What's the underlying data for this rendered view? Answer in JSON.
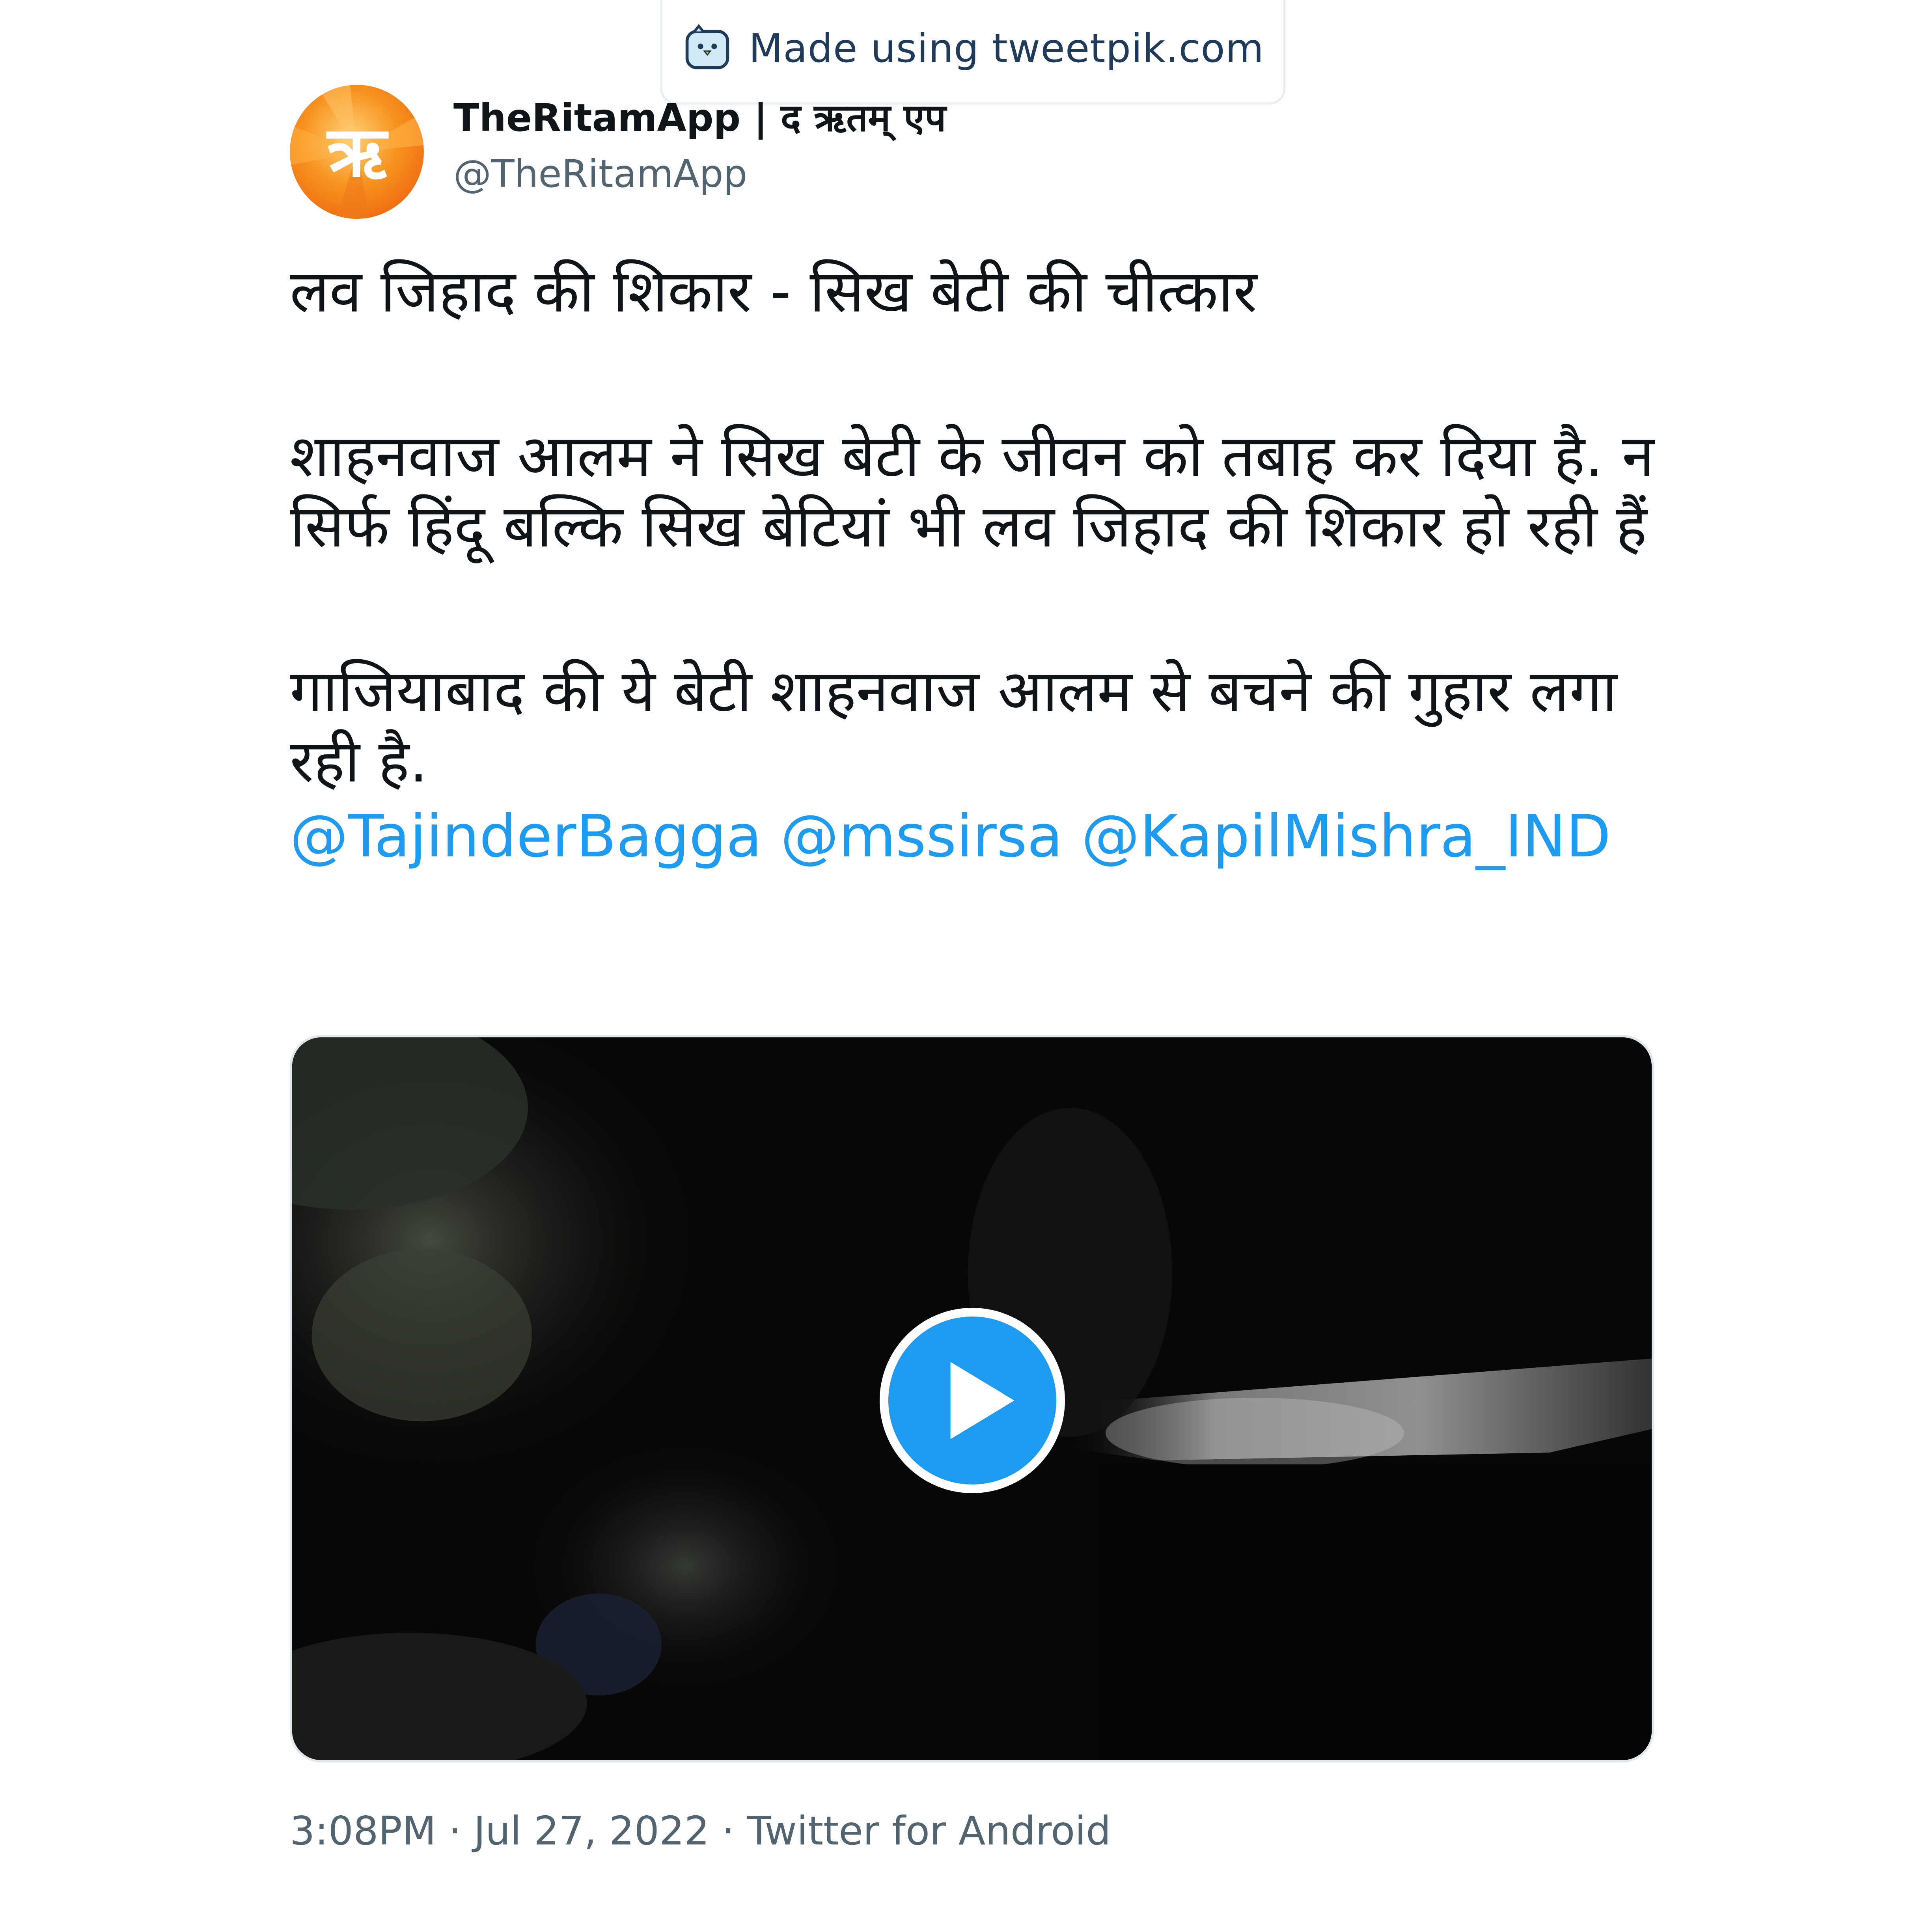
{
  "watermark": {
    "text": "Made using tweetpik.com",
    "icon": "bird-face-icon"
  },
  "author": {
    "name": "TheRitamApp | द ऋतम् एप",
    "handle": "@TheRitamApp",
    "avatar_text": "ऋ",
    "avatar_color": "#f7931e"
  },
  "tweet": {
    "paragraphs": [
      "लव जिहाद की शिकार - सिख बेटी की चीत्कार",
      "शाहनवाज आलम ने सिख बेटी के जीवन को तबाह कर दिया है. न सिर्फ हिंदू बल्कि सिख बेटियां भी लव जिहाद की शिकार हो रही हैं",
      "गाजियाबाद की ये बेटी शाहनवाज आलम से बचने की गुहार लगा रही है."
    ],
    "mentions": [
      "@TajinderBagga",
      "@mssirsa",
      "@KapilMishra_IND"
    ],
    "mention_color": "#1d9bf0"
  },
  "media": {
    "type": "video",
    "play_icon": "play-icon",
    "play_color": "#1d9bf0"
  },
  "meta": {
    "time": "3:08PM",
    "date": "Jul 27, 2022",
    "source": "Twitter for Android",
    "separator": "·"
  }
}
